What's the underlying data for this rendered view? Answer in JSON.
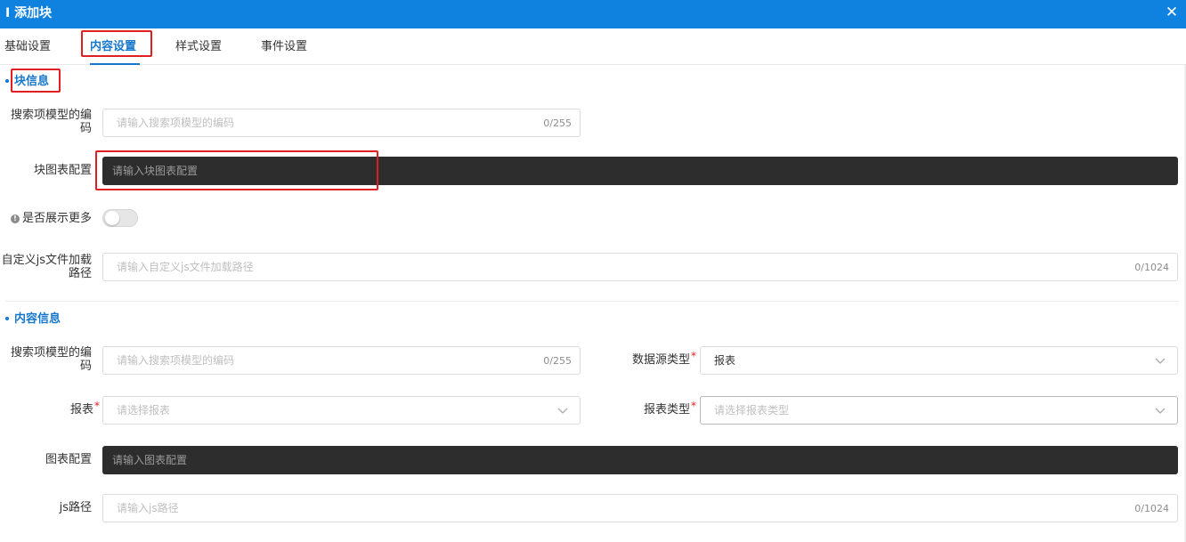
{
  "dialog": {
    "title": "I 添加块",
    "close_glyph": "✕"
  },
  "tabs": [
    {
      "label": "基础设置"
    },
    {
      "label": "内容设置",
      "active": true
    },
    {
      "label": "样式设置"
    },
    {
      "label": "事件设置"
    }
  ],
  "block_info": {
    "section_title": "块信息",
    "search_model_code": {
      "label": "搜索项模型的编码",
      "placeholder": "请输入搜索项模型的编码",
      "counter": "0/255"
    },
    "block_chart_config": {
      "label": "块图表配置",
      "placeholder": "请输入块图表配置"
    },
    "show_more": {
      "label": "是否展示更多",
      "info_glyph": "!",
      "on": false
    },
    "custom_js_path": {
      "label": "自定义js文件加载路径",
      "placeholder": "请输入自定义js文件加载路径",
      "counter": "0/1024"
    }
  },
  "content_info": {
    "section_title": "内容信息",
    "search_model_code": {
      "label": "搜索项模型的编码",
      "placeholder": "请输入搜索项模型的编码",
      "counter": "0/255"
    },
    "data_source_type": {
      "label": "数据源类型",
      "value": "报表"
    },
    "report": {
      "label": "报表",
      "placeholder": "请选择报表"
    },
    "report_type": {
      "label": "报表类型",
      "placeholder": "请选择报表类型"
    },
    "chart_config": {
      "label": "图表配置",
      "placeholder": "请输入图表配置"
    },
    "js_path": {
      "label": "js路径",
      "placeholder": "请输入js路径",
      "counter": "0/1024"
    }
  },
  "required_mark": "*",
  "colors": {
    "titlebar": "#0f82e0",
    "accent": "#1677cc",
    "highlight_box": "#e02020",
    "dark_input": "#2d2d2d"
  }
}
